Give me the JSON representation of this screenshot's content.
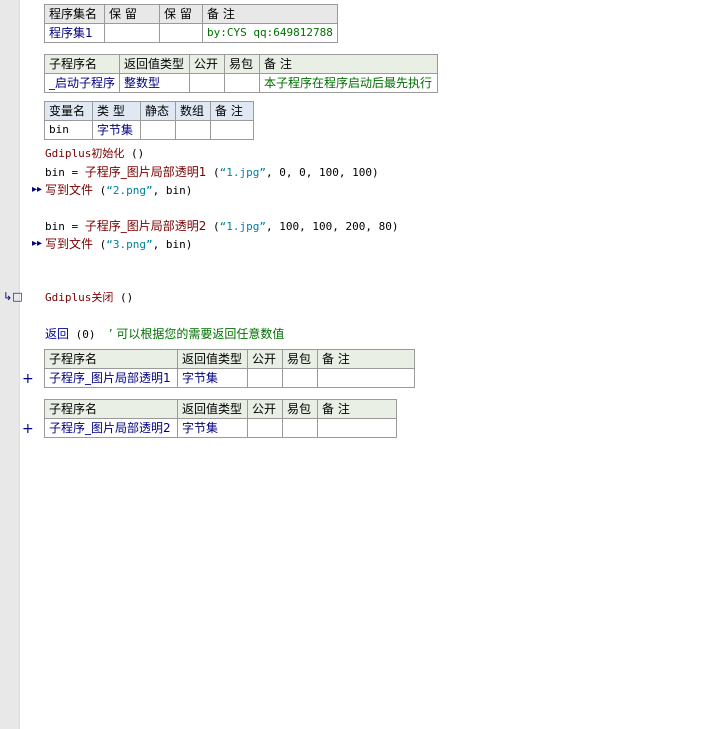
{
  "set_table": {
    "headers": [
      "程序集名",
      "保 留",
      "保 留",
      "备 注"
    ],
    "row": [
      "程序集1",
      "",
      "",
      "by:CYS qq:649812788"
    ]
  },
  "sub1_table": {
    "headers": [
      "子程序名",
      "返回值类型",
      "公开",
      "易包",
      "备 注"
    ],
    "row": [
      "_启动子程序",
      "整数型",
      "",
      "",
      "本子程序在程序启动后最先执行"
    ]
  },
  "var_table": {
    "headers": [
      "变量名",
      "类 型",
      "静态",
      "数组",
      "备 注"
    ],
    "row": [
      "bin",
      "字节集",
      "",
      "",
      ""
    ]
  },
  "code": {
    "line1_fn": "Gdiplus初始化",
    "line1_args": " ()",
    "line2_var": "bin",
    "line2_op": " = ",
    "line2_fn": "子程序_图片局部透明1",
    "line2_args_open": " (",
    "line2_str": "“1.jpg”",
    "line2_rest": ", 0, 0, 100, 100)",
    "line3_fn": "写到文件",
    "line3_open": " (",
    "line3_str": "“2.png”",
    "line3_rest": ", bin)",
    "line4_var": "bin",
    "line4_op": " = ",
    "line4_fn": "子程序_图片局部透明2",
    "line4_args_open": " (",
    "line4_str": "“1.jpg”",
    "line4_rest": ", 100, 100, 200, 80)",
    "line5_fn": "写到文件",
    "line5_open": " (",
    "line5_str": "“3.png”",
    "line5_rest": ", bin)",
    "line6_fn": "Gdiplus关闭",
    "line6_args": " ()",
    "line7_kw": "返回",
    "line7_args": " (0)  ",
    "line7_comment": "’ 可以根据您的需要返回任意数值"
  },
  "sub2_table": {
    "headers": [
      "子程序名",
      "返回值类型",
      "公开",
      "易包",
      "备 注"
    ],
    "row": [
      "子程序_图片局部透明1",
      "字节集",
      "",
      "",
      ""
    ]
  },
  "sub3_table": {
    "headers": [
      "子程序名",
      "返回值类型",
      "公开",
      "易包",
      "备 注"
    ],
    "row": [
      "子程序_图片局部透明2",
      "字节集",
      "",
      "",
      ""
    ]
  },
  "markers": {
    "arrow": "▸▸",
    "loop": "↳□",
    "plus": "+"
  }
}
